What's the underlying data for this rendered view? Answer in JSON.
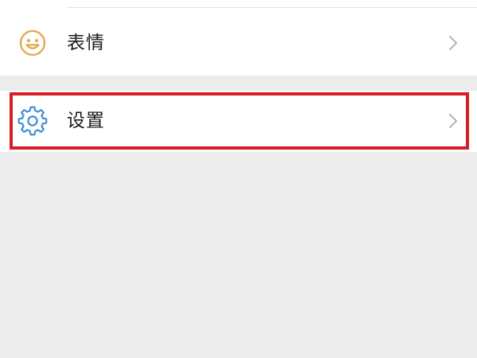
{
  "menu": {
    "items": [
      {
        "label": "表情",
        "icon": "smiley-icon",
        "icon_color": "#e0a84a"
      },
      {
        "label": "设置",
        "icon": "gear-icon",
        "icon_color": "#3f8ed6",
        "highlighted": true
      }
    ]
  },
  "colors": {
    "background": "#ececec",
    "surface": "#ffffff",
    "highlight": "#d71d25",
    "chevron": "#b4b4b4",
    "text": "#1b1b1b"
  }
}
